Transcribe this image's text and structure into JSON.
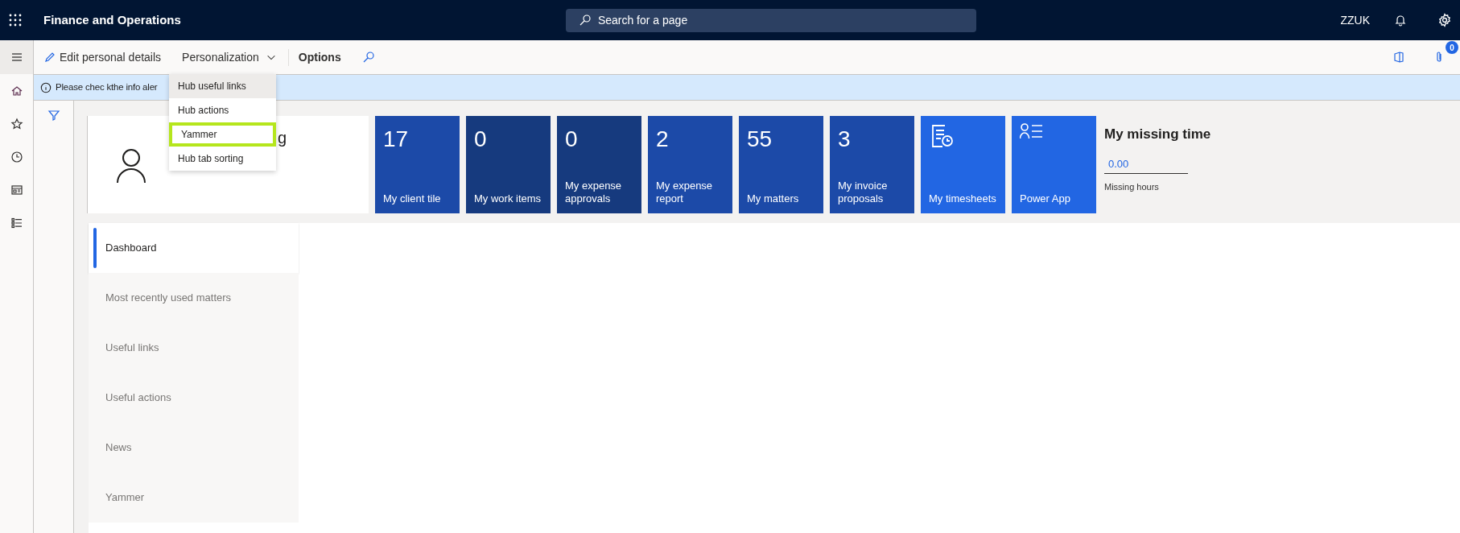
{
  "app_bar": {
    "title": "Finance and Operations",
    "search": {
      "placeholder": "Search for a page"
    },
    "company": "ZZUK"
  },
  "toolbar": {
    "items": [
      {
        "kind": "edit",
        "label": "Edit personal details"
      },
      {
        "kind": "dropdown",
        "label": "Personalization",
        "expanded": true
      },
      {
        "kind": "bold",
        "label": "Options"
      },
      {
        "kind": "search"
      }
    ],
    "attachments_badge": "0"
  },
  "menu": [
    {
      "label": "Hub useful links",
      "selected": true,
      "highlighted": false
    },
    {
      "label": "Hub actions",
      "selected": false,
      "highlighted": false
    },
    {
      "label": "Yammer",
      "selected": false,
      "highlighted": true
    },
    {
      "label": "Hub tab sorting",
      "selected": false,
      "highlighted": false
    }
  ],
  "info_bar": {
    "message": "Please chec kthe info aler"
  },
  "profile": {
    "name_visible": "g"
  },
  "tiles": [
    {
      "kind": "count",
      "value": "17",
      "label": "My client tile",
      "color": "#1c4aa8"
    },
    {
      "kind": "count",
      "value": "0",
      "label": "My work items",
      "color": "#163a7e"
    },
    {
      "kind": "count",
      "value": "0",
      "label": "My expense approvals",
      "color": "#163a7e"
    },
    {
      "kind": "count",
      "value": "2",
      "label": "My expense report",
      "color": "#1c4aa8"
    },
    {
      "kind": "count",
      "value": "55",
      "label": "My matters",
      "color": "#1c4aa8"
    },
    {
      "kind": "count",
      "value": "3",
      "label": "My invoice proposals",
      "color": "#1c4aa8"
    },
    {
      "kind": "timesheet",
      "label": "My timesheets",
      "color": "#2266e3"
    },
    {
      "kind": "app",
      "label": "Power App",
      "color": "#2266e3"
    }
  ],
  "missing_time": {
    "title": "My missing time",
    "value": "0.00",
    "caption": "Missing hours"
  },
  "tabs": [
    {
      "label": "Dashboard",
      "selected": true
    },
    {
      "label": "Most recently used matters",
      "selected": false
    },
    {
      "label": "Useful links",
      "selected": false
    },
    {
      "label": "Useful actions",
      "selected": false
    },
    {
      "label": "News",
      "selected": false
    },
    {
      "label": "Yammer",
      "selected": false
    }
  ]
}
